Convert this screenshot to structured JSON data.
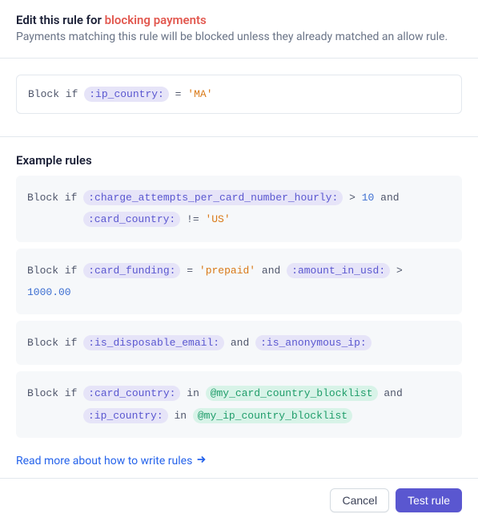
{
  "header": {
    "title_prefix": "Edit this rule for ",
    "title_accent": "blocking payments",
    "subtitle": "Payments matching this rule will be blocked unless they already matched an allow rule."
  },
  "editor": {
    "block_if": "Block if",
    "field": ":ip_country:",
    "op": "=",
    "value": "'MA'"
  },
  "examples": {
    "heading": "Example rules",
    "rows": [
      {
        "parts": [
          {
            "t": "kw",
            "v": "Block if"
          },
          {
            "t": "field",
            "v": ":charge_attempts_per_card_number_hourly:"
          },
          {
            "t": "op",
            "v": ">"
          },
          {
            "t": "num",
            "v": "10"
          },
          {
            "t": "kw",
            "v": "and"
          },
          {
            "t": "br"
          },
          {
            "t": "field",
            "v": ":card_country:"
          },
          {
            "t": "op",
            "v": "!="
          },
          {
            "t": "str",
            "v": "'US'"
          }
        ]
      },
      {
        "parts": [
          {
            "t": "kw",
            "v": "Block if"
          },
          {
            "t": "field",
            "v": ":card_funding:"
          },
          {
            "t": "op",
            "v": "="
          },
          {
            "t": "str",
            "v": "'prepaid'"
          },
          {
            "t": "kw",
            "v": "and"
          },
          {
            "t": "field",
            "v": ":amount_in_usd:"
          },
          {
            "t": "op",
            "v": ">"
          },
          {
            "t": "num",
            "v": "1000.00"
          }
        ]
      },
      {
        "parts": [
          {
            "t": "kw",
            "v": "Block if"
          },
          {
            "t": "field",
            "v": ":is_disposable_email:"
          },
          {
            "t": "kw",
            "v": "and"
          },
          {
            "t": "field",
            "v": ":is_anonymous_ip:"
          }
        ]
      },
      {
        "parts": [
          {
            "t": "kw",
            "v": "Block if"
          },
          {
            "t": "field",
            "v": ":card_country:"
          },
          {
            "t": "kw",
            "v": "in"
          },
          {
            "t": "list",
            "v": "@my_card_country_blocklist"
          },
          {
            "t": "kw",
            "v": "and"
          },
          {
            "t": "br"
          },
          {
            "t": "field",
            "v": ":ip_country:"
          },
          {
            "t": "kw",
            "v": "in"
          },
          {
            "t": "list",
            "v": "@my_ip_country_blocklist"
          }
        ]
      }
    ]
  },
  "link": {
    "label": "Read more about how to write rules"
  },
  "footer": {
    "cancel": "Cancel",
    "test": "Test rule"
  }
}
